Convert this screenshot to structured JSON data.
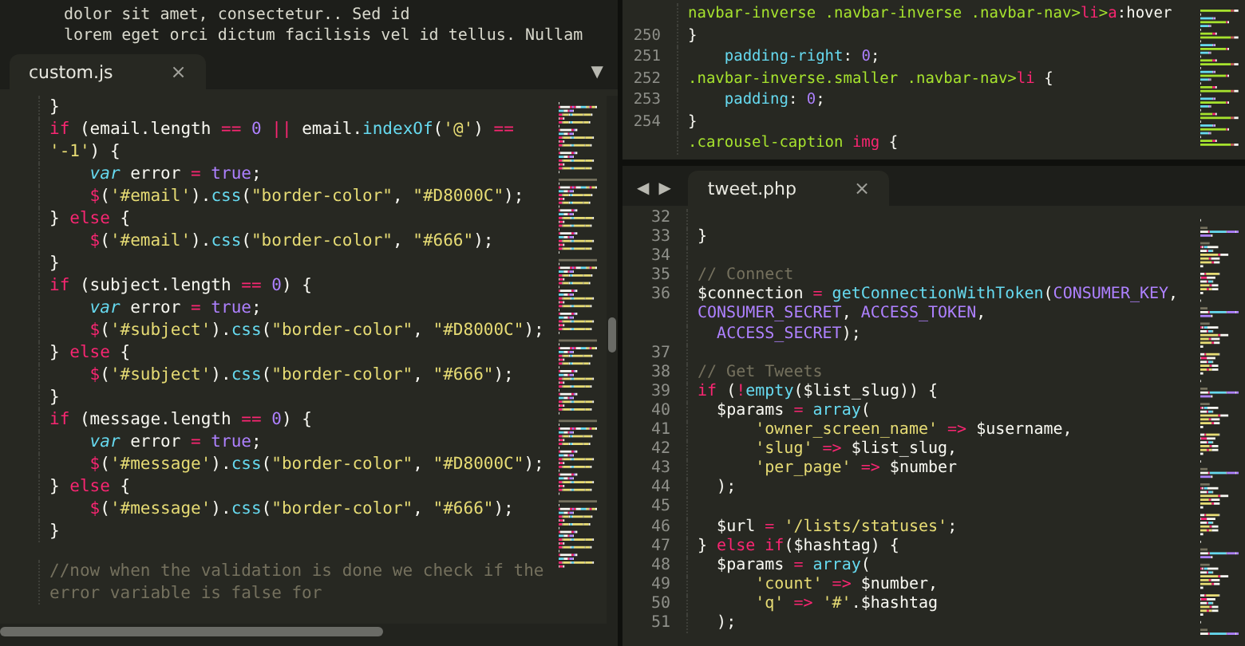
{
  "left_pane": {
    "background_window": {
      "lines": [
        "dolor sit amet, consectetur.. Sed id",
        "lorem eget orci dictum facilisis vel id tellus. Nullam"
      ]
    },
    "tab": {
      "label": "custom.js",
      "close": "×"
    },
    "panel_menu": "▼",
    "lines": [
      {
        "tokens": [
          {
            "kind": "plain",
            "text": "}"
          }
        ]
      },
      {
        "tokens": [
          {
            "kind": "keyword",
            "text": "if"
          },
          {
            "kind": "plain",
            "text": " (email.length"
          },
          {
            "kind": "keyword",
            "text": " =="
          },
          {
            "kind": "constant",
            "text": " 0"
          },
          {
            "kind": "keyword",
            "text": " ||"
          },
          {
            "kind": "plain",
            "text": " email."
          },
          {
            "kind": "function",
            "text": "indexOf"
          },
          {
            "kind": "plain",
            "text": "("
          },
          {
            "kind": "string",
            "text": "'@'"
          },
          {
            "kind": "plain",
            "text": ")"
          },
          {
            "kind": "keyword",
            "text": " =="
          },
          {
            "kind": "string",
            "text": " '-1'"
          },
          {
            "kind": "plain",
            "text": ") {"
          }
        ]
      },
      {
        "tokens": [
          {
            "kind": "storage",
            "text": "    var"
          },
          {
            "kind": "plain",
            "text": " error"
          },
          {
            "kind": "keyword",
            "text": " ="
          },
          {
            "kind": "constant",
            "text": " true"
          },
          {
            "kind": "plain",
            "text": ";"
          }
        ]
      },
      {
        "tokens": [
          {
            "kind": "keyword",
            "text": "    $"
          },
          {
            "kind": "plain",
            "text": "("
          },
          {
            "kind": "string",
            "text": "'#email'"
          },
          {
            "kind": "plain",
            "text": ")."
          },
          {
            "kind": "function",
            "text": "css"
          },
          {
            "kind": "plain",
            "text": "("
          },
          {
            "kind": "string",
            "text": "\"border-color\""
          },
          {
            "kind": "plain",
            "text": ","
          },
          {
            "kind": "string",
            "text": " \"#D8000C\""
          },
          {
            "kind": "plain",
            "text": ");"
          }
        ]
      },
      {
        "tokens": [
          {
            "kind": "plain",
            "text": "}"
          },
          {
            "kind": "keyword",
            "text": " else"
          },
          {
            "kind": "plain",
            "text": " {"
          }
        ]
      },
      {
        "tokens": [
          {
            "kind": "keyword",
            "text": "    $"
          },
          {
            "kind": "plain",
            "text": "("
          },
          {
            "kind": "string",
            "text": "'#email'"
          },
          {
            "kind": "plain",
            "text": ")."
          },
          {
            "kind": "function",
            "text": "css"
          },
          {
            "kind": "plain",
            "text": "("
          },
          {
            "kind": "string",
            "text": "\"border-color\""
          },
          {
            "kind": "plain",
            "text": ","
          },
          {
            "kind": "string",
            "text": " \"#666\""
          },
          {
            "kind": "plain",
            "text": ");"
          }
        ]
      },
      {
        "tokens": [
          {
            "kind": "plain",
            "text": "}"
          }
        ]
      },
      {
        "tokens": [
          {
            "kind": "keyword",
            "text": "if"
          },
          {
            "kind": "plain",
            "text": " (subject.length"
          },
          {
            "kind": "keyword",
            "text": " =="
          },
          {
            "kind": "constant",
            "text": " 0"
          },
          {
            "kind": "plain",
            "text": ") {"
          }
        ]
      },
      {
        "tokens": [
          {
            "kind": "storage",
            "text": "    var"
          },
          {
            "kind": "plain",
            "text": " error"
          },
          {
            "kind": "keyword",
            "text": " ="
          },
          {
            "kind": "constant",
            "text": " true"
          },
          {
            "kind": "plain",
            "text": ";"
          }
        ]
      },
      {
        "tokens": [
          {
            "kind": "keyword",
            "text": "    $"
          },
          {
            "kind": "plain",
            "text": "("
          },
          {
            "kind": "string",
            "text": "'#subject'"
          },
          {
            "kind": "plain",
            "text": ")."
          },
          {
            "kind": "function",
            "text": "css"
          },
          {
            "kind": "plain",
            "text": "("
          },
          {
            "kind": "string",
            "text": "\"border-color\""
          },
          {
            "kind": "plain",
            "text": ","
          },
          {
            "kind": "string",
            "text": " \"#D8000C\""
          },
          {
            "kind": "plain",
            "text": ");"
          }
        ]
      },
      {
        "tokens": [
          {
            "kind": "plain",
            "text": "}"
          },
          {
            "kind": "keyword",
            "text": " else"
          },
          {
            "kind": "plain",
            "text": " {"
          }
        ]
      },
      {
        "tokens": [
          {
            "kind": "keyword",
            "text": "    $"
          },
          {
            "kind": "plain",
            "text": "("
          },
          {
            "kind": "string",
            "text": "'#subject'"
          },
          {
            "kind": "plain",
            "text": ")."
          },
          {
            "kind": "function",
            "text": "css"
          },
          {
            "kind": "plain",
            "text": "("
          },
          {
            "kind": "string",
            "text": "\"border-color\""
          },
          {
            "kind": "plain",
            "text": ","
          },
          {
            "kind": "string",
            "text": " \"#666\""
          },
          {
            "kind": "plain",
            "text": ");"
          }
        ]
      },
      {
        "tokens": [
          {
            "kind": "plain",
            "text": "}"
          }
        ]
      },
      {
        "tokens": [
          {
            "kind": "keyword",
            "text": "if"
          },
          {
            "kind": "plain",
            "text": " (message.length"
          },
          {
            "kind": "keyword",
            "text": " =="
          },
          {
            "kind": "constant",
            "text": " 0"
          },
          {
            "kind": "plain",
            "text": ") {"
          }
        ]
      },
      {
        "tokens": [
          {
            "kind": "storage",
            "text": "    var"
          },
          {
            "kind": "plain",
            "text": " error"
          },
          {
            "kind": "keyword",
            "text": " ="
          },
          {
            "kind": "constant",
            "text": " true"
          },
          {
            "kind": "plain",
            "text": ";"
          }
        ]
      },
      {
        "tokens": [
          {
            "kind": "keyword",
            "text": "    $"
          },
          {
            "kind": "plain",
            "text": "("
          },
          {
            "kind": "string",
            "text": "'#message'"
          },
          {
            "kind": "plain",
            "text": ")."
          },
          {
            "kind": "function",
            "text": "css"
          },
          {
            "kind": "plain",
            "text": "("
          },
          {
            "kind": "string",
            "text": "\"border-color\""
          },
          {
            "kind": "plain",
            "text": ","
          },
          {
            "kind": "string",
            "text": " \"#D8000C\""
          },
          {
            "kind": "plain",
            "text": ");"
          }
        ]
      },
      {
        "tokens": [
          {
            "kind": "plain",
            "text": "}"
          },
          {
            "kind": "keyword",
            "text": " else"
          },
          {
            "kind": "plain",
            "text": " {"
          }
        ]
      },
      {
        "tokens": [
          {
            "kind": "keyword",
            "text": "    $"
          },
          {
            "kind": "plain",
            "text": "("
          },
          {
            "kind": "string",
            "text": "'#message'"
          },
          {
            "kind": "plain",
            "text": ")."
          },
          {
            "kind": "function",
            "text": "css"
          },
          {
            "kind": "plain",
            "text": "("
          },
          {
            "kind": "string",
            "text": "\"border-color\""
          },
          {
            "kind": "plain",
            "text": ","
          },
          {
            "kind": "string",
            "text": " \"#666\""
          },
          {
            "kind": "plain",
            "text": ");"
          }
        ]
      },
      {
        "tokens": [
          {
            "kind": "plain",
            "text": "}"
          }
        ]
      },
      {
        "kind": "blank"
      },
      {
        "tokens": [
          {
            "kind": "comment",
            "text": "//now when the validation is done we check if the error variable is false for"
          }
        ]
      }
    ]
  },
  "right_top_pane": {
    "lines": [
      {
        "tokens": [
          {
            "kind": "selector",
            "text": "navbar-inverse .navbar-inverse .navbar-nav>"
          },
          {
            "kind": "keyword",
            "text": "li"
          },
          {
            "kind": "selector",
            "text": ">"
          },
          {
            "kind": "keyword",
            "text": "a"
          },
          {
            "kind": "plain",
            "text": ":hover"
          }
        ]
      },
      {
        "number": "250",
        "tokens": [
          {
            "kind": "plain",
            "text": "}"
          }
        ]
      },
      {
        "number": "251",
        "tokens": [
          {
            "kind": "property",
            "text": "    padding-right"
          },
          {
            "kind": "plain",
            "text": ":"
          },
          {
            "kind": "constant",
            "text": " 0"
          },
          {
            "kind": "plain",
            "text": ";"
          }
        ]
      },
      {
        "number": "252",
        "tokens": [
          {
            "kind": "selector",
            "text": ".navbar-inverse.smaller .navbar-nav>"
          },
          {
            "kind": "keyword",
            "text": "li"
          },
          {
            "kind": "plain",
            "text": " {"
          }
        ]
      },
      {
        "number": "253",
        "tokens": [
          {
            "kind": "property",
            "text": "    padding"
          },
          {
            "kind": "plain",
            "text": ":"
          },
          {
            "kind": "constant",
            "text": " 0"
          },
          {
            "kind": "plain",
            "text": ";"
          }
        ]
      },
      {
        "number": "254",
        "tokens": [
          {
            "kind": "plain",
            "text": "}"
          }
        ]
      },
      {
        "tokens": [
          {
            "kind": "selector",
            "text": ".carousel-caption"
          },
          {
            "kind": "keyword",
            "text": " img"
          },
          {
            "kind": "plain",
            "text": " {"
          }
        ]
      }
    ]
  },
  "right_bottom_pane": {
    "nav_arrows": [
      "◀",
      "▶"
    ],
    "tab": {
      "label": "tweet.php",
      "close": "×"
    },
    "lines": [
      {
        "number": "32"
      },
      {
        "number": "33",
        "tokens": [
          {
            "kind": "plain",
            "text": "}"
          }
        ]
      },
      {
        "number": "34"
      },
      {
        "number": "35",
        "tokens": [
          {
            "kind": "comment",
            "text": "// Connect"
          }
        ]
      },
      {
        "number": "36",
        "tokens": [
          {
            "kind": "plain",
            "text": "$connection"
          },
          {
            "kind": "keyword",
            "text": " ="
          },
          {
            "kind": "function",
            "text": " getConnectionWithToken"
          },
          {
            "kind": "plain",
            "text": "("
          },
          {
            "kind": "constant",
            "text": "CONSUMER_KEY"
          },
          {
            "kind": "plain",
            "text": ","
          },
          {
            "kind": "constant",
            "text": " CONSUMER_SECRET"
          },
          {
            "kind": "plain",
            "text": ","
          },
          {
            "kind": "constant",
            "text": " ACCESS_TOKEN"
          },
          {
            "kind": "plain",
            "text": ","
          }
        ]
      },
      {
        "tokens": [
          {
            "kind": "constant",
            "text": "  ACCESS_SECRET"
          },
          {
            "kind": "plain",
            "text": ");"
          }
        ]
      },
      {
        "number": "37"
      },
      {
        "number": "38",
        "tokens": [
          {
            "kind": "comment",
            "text": "// Get Tweets"
          }
        ]
      },
      {
        "number": "39",
        "tokens": [
          {
            "kind": "keyword",
            "text": "if"
          },
          {
            "kind": "plain",
            "text": " ("
          },
          {
            "kind": "keyword",
            "text": "!"
          },
          {
            "kind": "function",
            "text": "empty"
          },
          {
            "kind": "plain",
            "text": "($list_slug)) {"
          }
        ]
      },
      {
        "number": "40",
        "tokens": [
          {
            "kind": "plain",
            "text": "  $params"
          },
          {
            "kind": "keyword",
            "text": " ="
          },
          {
            "kind": "function",
            "text": " array"
          },
          {
            "kind": "plain",
            "text": "("
          }
        ]
      },
      {
        "number": "41",
        "tokens": [
          {
            "kind": "string",
            "text": "      'owner_screen_name'"
          },
          {
            "kind": "keyword",
            "text": " =>"
          },
          {
            "kind": "plain",
            "text": " $username,"
          }
        ]
      },
      {
        "number": "42",
        "tokens": [
          {
            "kind": "string",
            "text": "      'slug'"
          },
          {
            "kind": "keyword",
            "text": " =>"
          },
          {
            "kind": "plain",
            "text": " $list_slug,"
          }
        ]
      },
      {
        "number": "43",
        "tokens": [
          {
            "kind": "string",
            "text": "      'per_page'"
          },
          {
            "kind": "keyword",
            "text": " =>"
          },
          {
            "kind": "plain",
            "text": " $number"
          }
        ]
      },
      {
        "number": "44",
        "tokens": [
          {
            "kind": "plain",
            "text": "  );"
          }
        ]
      },
      {
        "number": "45"
      },
      {
        "number": "46",
        "tokens": [
          {
            "kind": "plain",
            "text": "  $url"
          },
          {
            "kind": "keyword",
            "text": " ="
          },
          {
            "kind": "string",
            "text": " '/lists/statuses'"
          },
          {
            "kind": "plain",
            "text": ";"
          }
        ]
      },
      {
        "number": "47",
        "tokens": [
          {
            "kind": "plain",
            "text": "}"
          },
          {
            "kind": "keyword",
            "text": " else if"
          },
          {
            "kind": "plain",
            "text": "($hashtag) {"
          }
        ]
      },
      {
        "number": "48",
        "tokens": [
          {
            "kind": "plain",
            "text": "  $params"
          },
          {
            "kind": "keyword",
            "text": " ="
          },
          {
            "kind": "function",
            "text": " array"
          },
          {
            "kind": "plain",
            "text": "("
          }
        ]
      },
      {
        "number": "49",
        "tokens": [
          {
            "kind": "string",
            "text": "      'count'"
          },
          {
            "kind": "keyword",
            "text": " =>"
          },
          {
            "kind": "plain",
            "text": " $number,"
          }
        ]
      },
      {
        "number": "50",
        "tokens": [
          {
            "kind": "string",
            "text": "      'q'"
          },
          {
            "kind": "keyword",
            "text": " =>"
          },
          {
            "kind": "string",
            "text": " '#'"
          },
          {
            "kind": "plain",
            "text": ".$hashtag"
          }
        ]
      },
      {
        "number": "51",
        "tokens": [
          {
            "kind": "plain",
            "text": "  );"
          }
        ]
      }
    ]
  }
}
